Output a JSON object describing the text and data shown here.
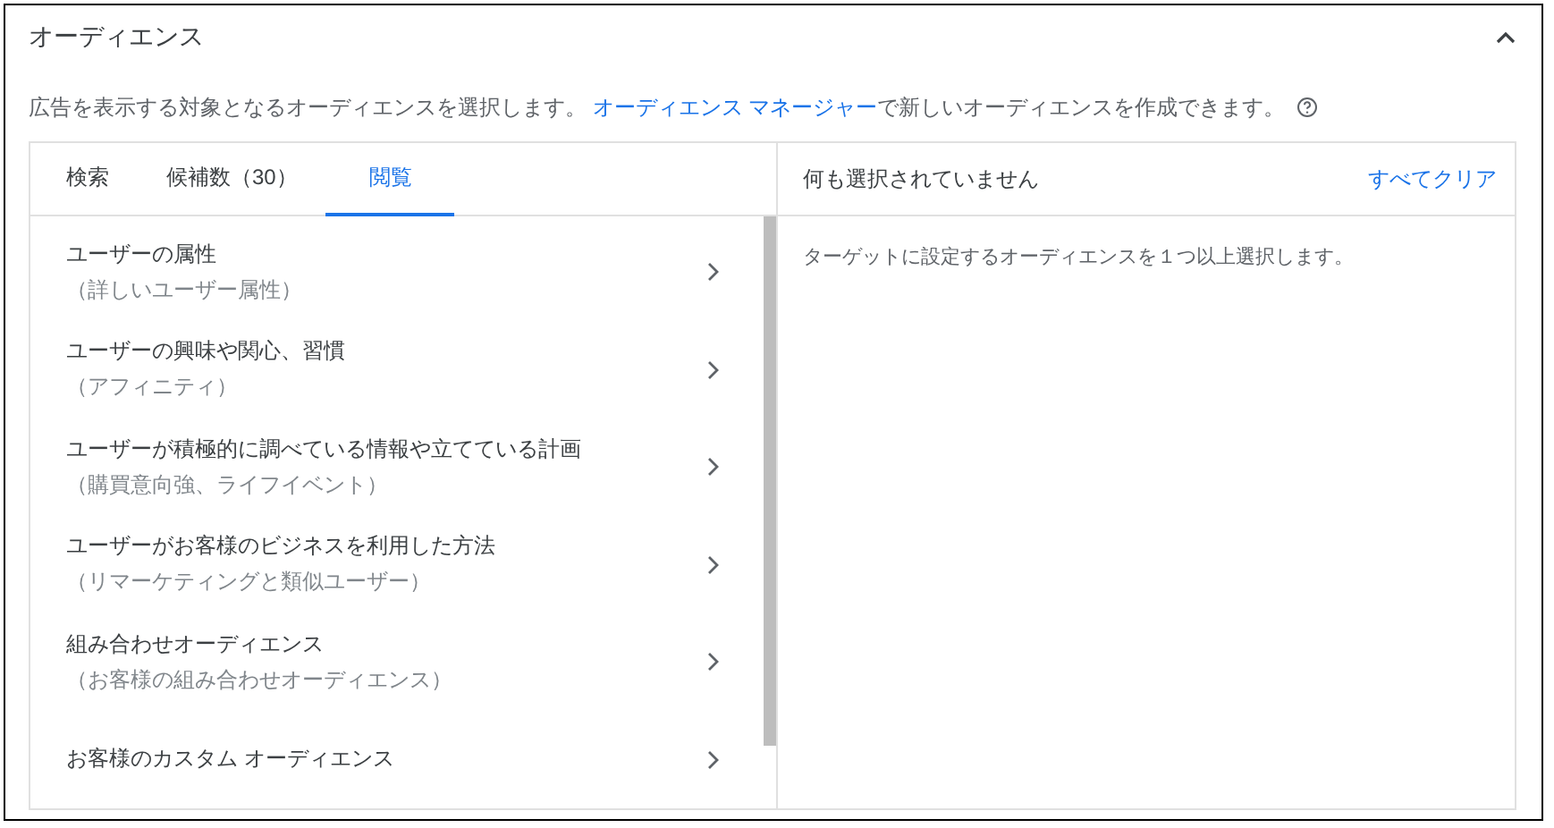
{
  "section": {
    "title": "オーディエンス",
    "expanded": true,
    "description_before": "広告を表示する対象となるオーディエンスを選択します。",
    "description_link": "オーディエンス マネージャー",
    "description_after": "で新しいオーディエンスを作成できます。"
  },
  "tabs": [
    {
      "label": "検索",
      "selected": false
    },
    {
      "label": "候補数（30）",
      "selected": false
    },
    {
      "label": "閲覧",
      "selected": true
    }
  ],
  "browse_items": [
    {
      "title": "ユーザーの属性",
      "subtitle": "（詳しいユーザー属性）"
    },
    {
      "title": "ユーザーの興味や関心、習慣",
      "subtitle": "（アフィニティ）"
    },
    {
      "title": "ユーザーが積極的に調べている情報や立てている計画",
      "subtitle": "（購買意向強、ライフイベント）"
    },
    {
      "title": "ユーザーがお客様のビジネスを利用した方法",
      "subtitle": "（リマーケティングと類似ユーザー）"
    },
    {
      "title": "組み合わせオーディエンス",
      "subtitle": "（お客様の組み合わせオーディエンス）"
    },
    {
      "title": "お客様のカスタム オーディエンス"
    }
  ],
  "selection": {
    "status": "何も選択されていません",
    "clear_all": "すべてクリア",
    "hint": "ターゲットに設定するオーディエンスを１つ以上選択します。"
  }
}
